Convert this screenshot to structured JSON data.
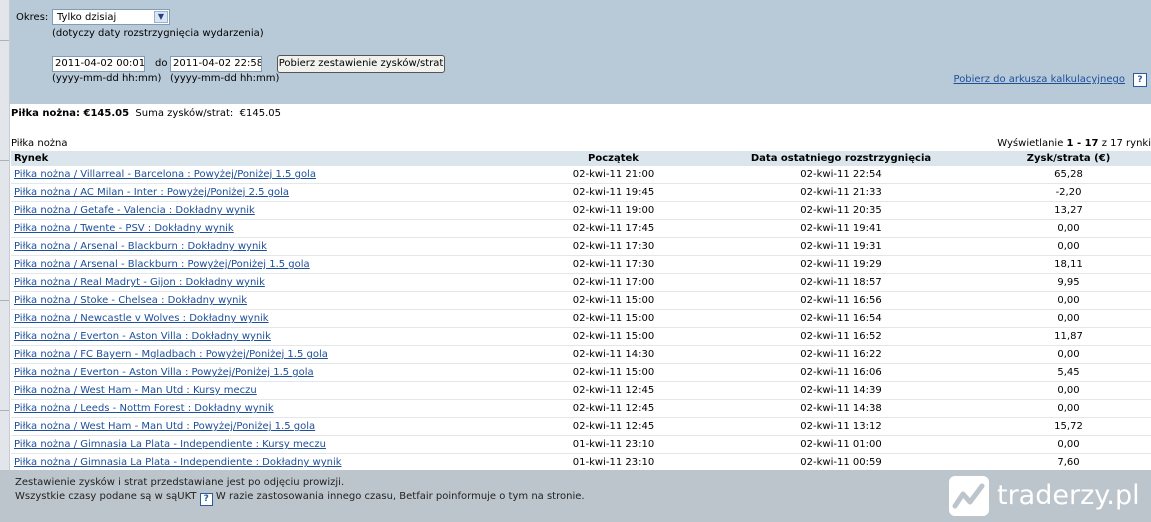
{
  "filter": {
    "okres_label": "Okres:",
    "okres_value": "Tylko dzisiaj",
    "okres_note": "(dotyczy daty rozstrzygnięcia wydarzenia)",
    "date_from": "2011-04-02 00:01",
    "to_label": "do",
    "date_to": "2011-04-02 22:58",
    "format_from": "(yyyy-mm-dd hh:mm)",
    "format_to": "(yyyy-mm-dd hh:mm)",
    "fetch_button": "Pobierz zestawienie zysków/strat",
    "xls_link": "Pobierz do arkusza kalkulacyjnego",
    "help_icon": "?"
  },
  "summary": {
    "sport_total": "Piłka nożna: €145.05",
    "sum_label": "Suma zysków/strat:",
    "sum_value": "€145.05"
  },
  "section": {
    "title": "Piłka nożna",
    "showing_prefix": "Wyświetlanie",
    "showing_range": "1 - 17",
    "showing_suffix": "z 17 rynki"
  },
  "table": {
    "headers": [
      "Rynek",
      "Początek",
      "Data ostatniego rozstrzygnięcia",
      "Zysk/strata (€)"
    ],
    "rows": [
      {
        "market": "Piłka nożna / Villarreal - Barcelona : Powyżej/Poniżej 1.5 gola",
        "start": "02-kwi-11 21:00",
        "settled": "02-kwi-11 22:54",
        "pl": "65,28"
      },
      {
        "market": "Piłka nożna / AC Milan - Inter : Powyżej/Poniżej 2.5 gola",
        "start": "02-kwi-11 19:45",
        "settled": "02-kwi-11 21:33",
        "pl": "-2,20"
      },
      {
        "market": "Piłka nożna / Getafe - Valencia : Dokładny wynik",
        "start": "02-kwi-11 19:00",
        "settled": "02-kwi-11 20:35",
        "pl": "13,27"
      },
      {
        "market": "Piłka nożna / Twente - PSV : Dokładny wynik",
        "start": "02-kwi-11 17:45",
        "settled": "02-kwi-11 19:41",
        "pl": "0,00"
      },
      {
        "market": "Piłka nożna / Arsenal - Blackburn : Dokładny wynik",
        "start": "02-kwi-11 17:30",
        "settled": "02-kwi-11 19:31",
        "pl": "0,00"
      },
      {
        "market": "Piłka nożna / Arsenal - Blackburn : Powyżej/Poniżej 1.5 gola",
        "start": "02-kwi-11 17:30",
        "settled": "02-kwi-11 19:29",
        "pl": "18,11"
      },
      {
        "market": "Piłka nożna / Real Madryt - Gijon : Dokładny wynik",
        "start": "02-kwi-11 17:00",
        "settled": "02-kwi-11 18:57",
        "pl": "9,95"
      },
      {
        "market": "Piłka nożna / Stoke - Chelsea : Dokładny wynik",
        "start": "02-kwi-11 15:00",
        "settled": "02-kwi-11 16:56",
        "pl": "0,00"
      },
      {
        "market": "Piłka nożna / Newcastle v Wolves : Dokładny wynik",
        "start": "02-kwi-11 15:00",
        "settled": "02-kwi-11 16:54",
        "pl": "0,00"
      },
      {
        "market": "Piłka nożna / Everton - Aston Villa : Dokładny wynik",
        "start": "02-kwi-11 15:00",
        "settled": "02-kwi-11 16:52",
        "pl": "11,87"
      },
      {
        "market": "Piłka nożna / FC Bayern - Mgladbach : Powyżej/Poniżej 1.5 gola",
        "start": "02-kwi-11 14:30",
        "settled": "02-kwi-11 16:22",
        "pl": "0,00"
      },
      {
        "market": "Piłka nożna / Everton - Aston Villa : Powyżej/Poniżej 1.5 gola",
        "start": "02-kwi-11 15:00",
        "settled": "02-kwi-11 16:06",
        "pl": "5,45"
      },
      {
        "market": "Piłka nożna / West Ham - Man Utd : Kursy meczu",
        "start": "02-kwi-11 12:45",
        "settled": "02-kwi-11 14:39",
        "pl": "0,00"
      },
      {
        "market": "Piłka nożna / Leeds - Nottm Forest : Dokładny wynik",
        "start": "02-kwi-11 12:45",
        "settled": "02-kwi-11 14:38",
        "pl": "0,00"
      },
      {
        "market": "Piłka nożna / West Ham - Man Utd : Powyżej/Poniżej 1.5 gola",
        "start": "02-kwi-11 12:45",
        "settled": "02-kwi-11 13:12",
        "pl": "15,72"
      },
      {
        "market": "Piłka nożna / Gimnasia La Plata - Independiente : Kursy meczu",
        "start": "01-kwi-11 23:10",
        "settled": "02-kwi-11 01:00",
        "pl": "0,00"
      },
      {
        "market": "Piłka nożna / Gimnasia La Plata - Independiente : Dokładny wynik",
        "start": "01-kwi-11 23:10",
        "settled": "02-kwi-11 00:59",
        "pl": "7,60"
      }
    ]
  },
  "footer": {
    "line1": "Zestawienie zysków i strat przedstawiane jest po odjęciu prowizji.",
    "line2_a": "Wszystkie czasy podane są w sąUKT",
    "line2_b": "W razie zastosowania innego czasu, Betfair poinformuje o tym na stronie.",
    "help_icon": "?"
  },
  "watermark": {
    "text": "traderzy.pl",
    "icon": "chart-logo-icon"
  }
}
